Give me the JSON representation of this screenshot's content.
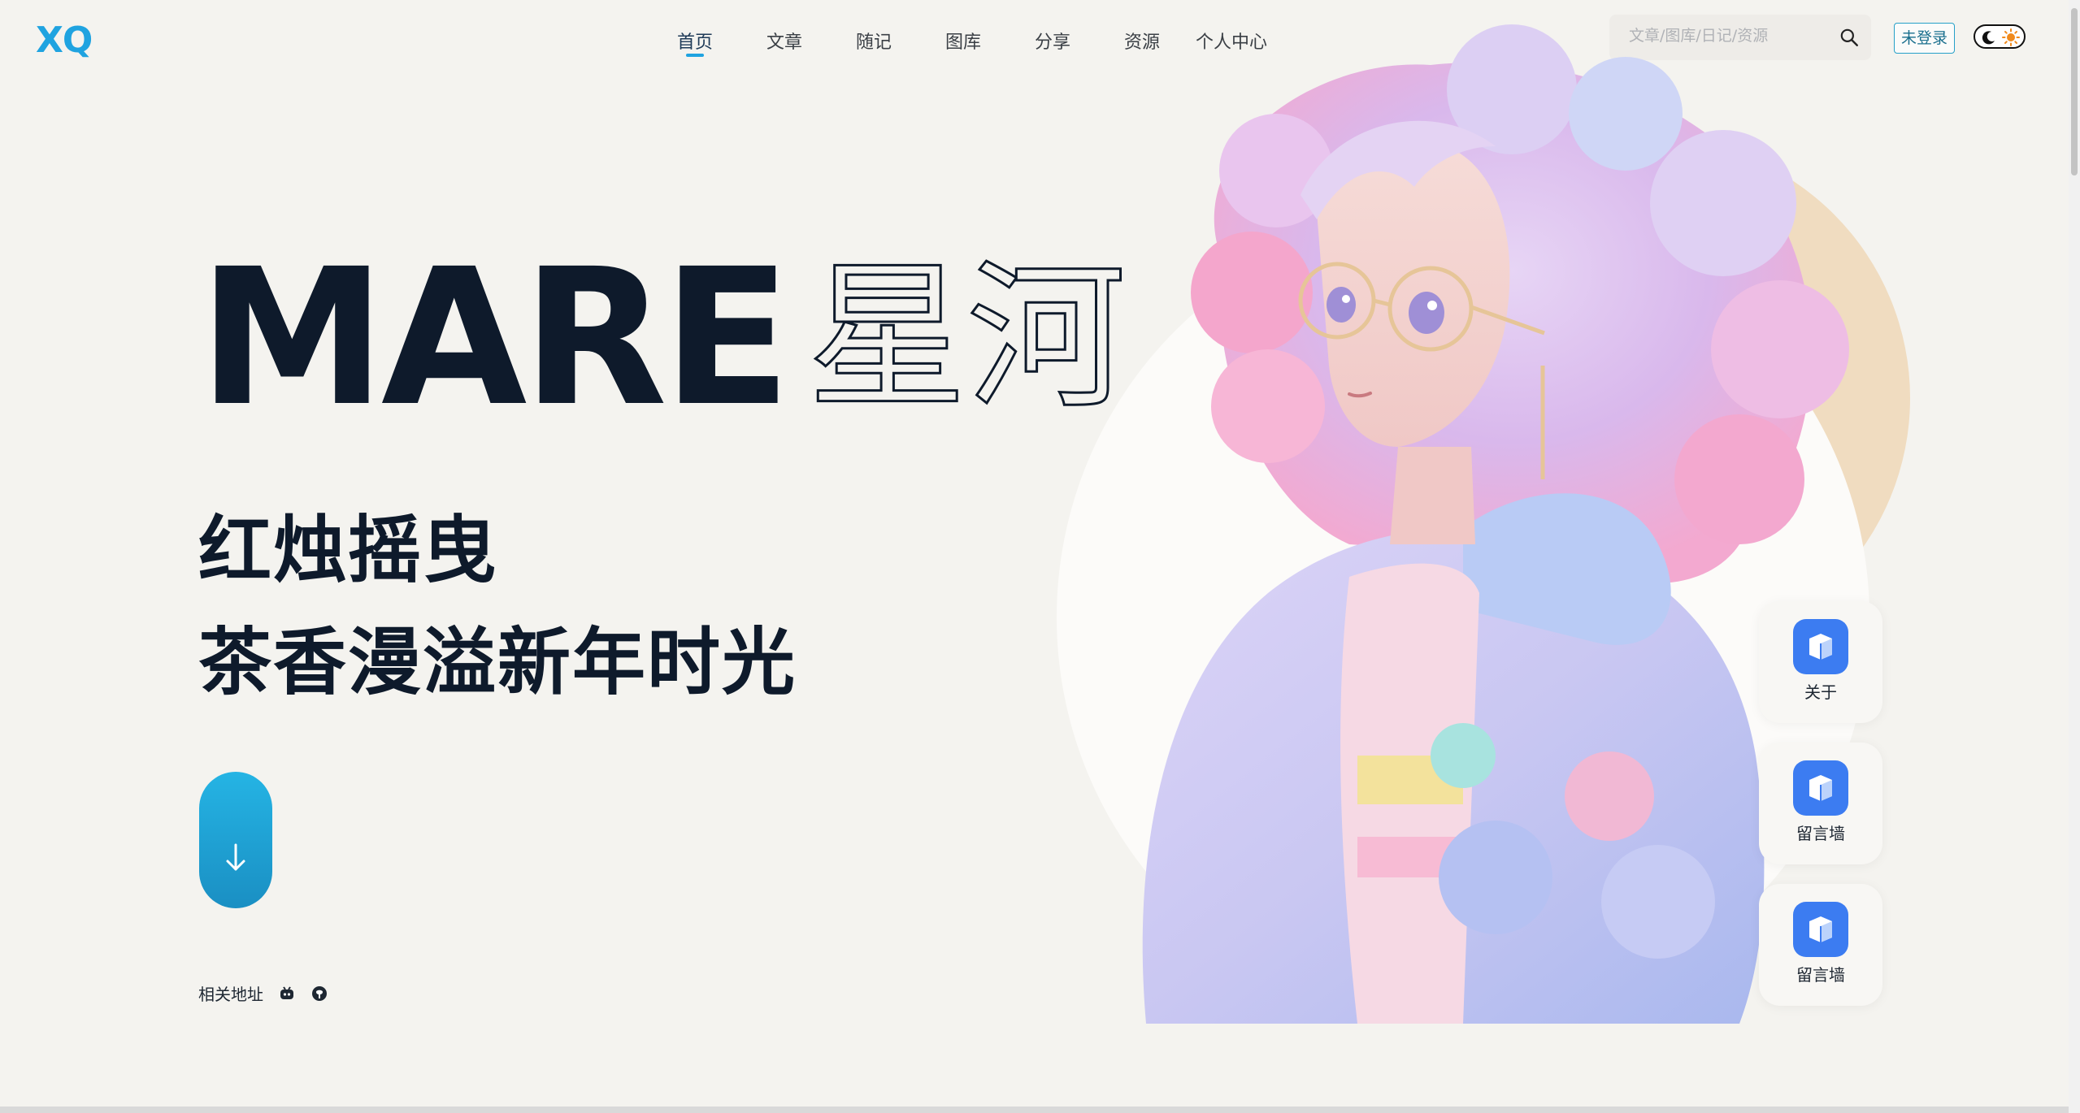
{
  "brand": {
    "logo": "XQ",
    "accent": "#1fa3e0"
  },
  "nav": {
    "items": [
      {
        "label": "首页",
        "active": true
      },
      {
        "label": "文章"
      },
      {
        "label": "随记"
      },
      {
        "label": "图库"
      },
      {
        "label": "分享"
      },
      {
        "label": "资源"
      },
      {
        "label": "个人中心"
      }
    ]
  },
  "search": {
    "placeholder": "文章/图库/日记/资源",
    "icon": "search-icon"
  },
  "auth": {
    "login_label": "未登录"
  },
  "theme": {
    "icons": [
      "moon-icon",
      "sun-icon"
    ]
  },
  "hero": {
    "title_en": "MARE",
    "title_zh": "星河",
    "line1": "红烛摇曳",
    "line2": "茶香漫溢新年时光",
    "scroll_icon": "arrow-down-icon",
    "links_label": "相关地址",
    "link_icons": [
      "robot-icon",
      "github-icon"
    ]
  },
  "side_cards": [
    {
      "label": "关于",
      "icon": "cube-icon"
    },
    {
      "label": "留言墙",
      "icon": "cube-icon"
    },
    {
      "label": "留言墙",
      "icon": "cube-icon"
    }
  ],
  "colors": {
    "background": "#f4f3ef",
    "card_icon": "#3c7cf1",
    "text": "#0e1a2b"
  }
}
